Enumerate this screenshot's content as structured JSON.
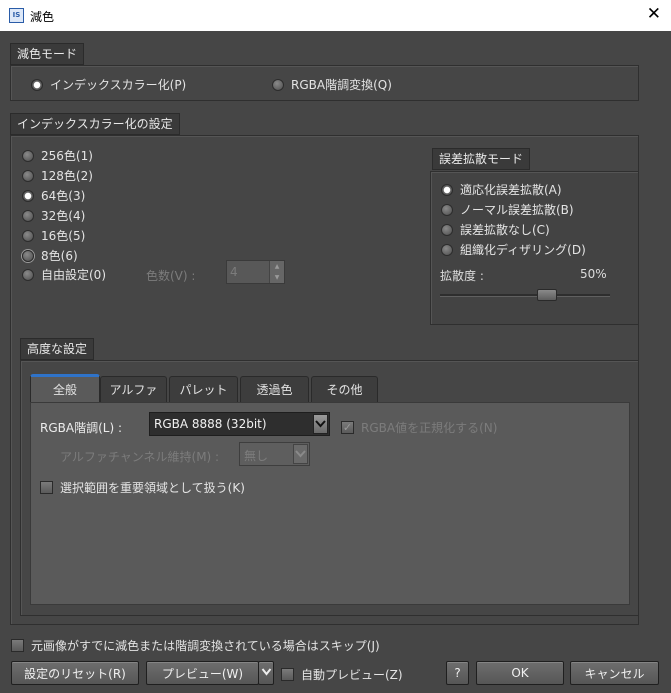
{
  "window": {
    "title": "減色",
    "app_icon": "IS",
    "close_glyph": "✕"
  },
  "mode_group": {
    "label": "減色モード",
    "options": [
      {
        "label": "インデックスカラー化(P)",
        "selected": true
      },
      {
        "label": "RGBA階調変換(Q)",
        "selected": false
      }
    ]
  },
  "index_group": {
    "label": "インデックスカラー化の設定",
    "colors": [
      {
        "label": "256色(1)",
        "selected": false
      },
      {
        "label": "128色(2)",
        "selected": false
      },
      {
        "label": "64色(3)",
        "selected": true
      },
      {
        "label": "32色(4)",
        "selected": false
      },
      {
        "label": "16色(5)",
        "selected": false
      },
      {
        "label": "8色(6)",
        "selected": false
      },
      {
        "label": "自由設定(0)",
        "selected": false
      }
    ],
    "color_count_label": "色数(V) :",
    "color_count_value": "4",
    "diffusion": {
      "label": "誤差拡散モード",
      "options": [
        {
          "label": "適応化誤差拡散(A)",
          "selected": true
        },
        {
          "label": "ノーマル誤差拡散(B)",
          "selected": false
        },
        {
          "label": "誤差拡散なし(C)",
          "selected": false
        },
        {
          "label": "組織化ディザリング(D)",
          "selected": false
        }
      ],
      "strength_label": "拡散度 :",
      "strength_value": "50%",
      "strength_fraction": 0.5
    }
  },
  "advanced": {
    "label": "高度な設定",
    "tabs": [
      "全般",
      "アルファ",
      "パレット",
      "透過色",
      "その他"
    ],
    "active_tab": 0,
    "rgba_label": "RGBA階調(L) :",
    "rgba_value": "RGBA 8888 (32bit)",
    "normalize_label": "RGBA値を正規化する(N)",
    "normalize_checked": true,
    "alpha_label": "アルファチャンネル維持(M) :",
    "alpha_value": "無し",
    "important_label": "選択範囲を重要領域として扱う(K)",
    "important_checked": false
  },
  "skip_label": "元画像がすでに減色または階調変換されている場合はスキップ(J)",
  "skip_checked": false,
  "footer": {
    "reset": "設定のリセット(R)",
    "preview": "プレビュー(W)",
    "auto_preview": "自動プレビュー(Z)",
    "auto_preview_checked": false,
    "help": "?",
    "ok": "OK",
    "cancel": "キャンセル"
  },
  "icons": {
    "dropdown": "chevron-down-icon",
    "spin_up": "▲",
    "spin_down": "▼",
    "check": "✓"
  },
  "colors": {
    "background": "#464646",
    "accent": "#2f73c9",
    "panel": "#5a5a5a"
  }
}
